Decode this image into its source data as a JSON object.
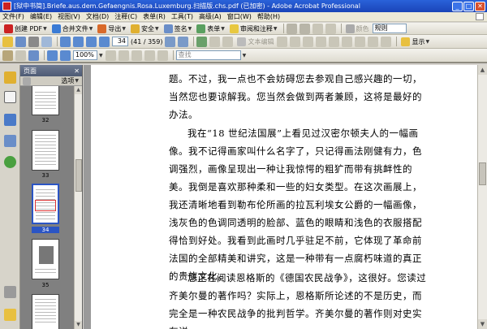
{
  "window": {
    "title": "[狱中书简].Briefe.aus.dem.Gefaengnis.Rosa.Luxemburg.扫描版.chs.pdf (已加密) - Adobe Acrobat Professional"
  },
  "menu": [
    "文件(F)",
    "编辑(E)",
    "视图(V)",
    "文档(D)",
    "注释(C)",
    "表单(R)",
    "工具(T)",
    "高级(A)",
    "窗口(W)",
    "帮助(H)"
  ],
  "toolbar1": {
    "create_pdf": "创建 PDF",
    "combine": "合并文件",
    "export": "导出",
    "secure": "安全",
    "sign": "签名",
    "forms": "表单",
    "review": "审阅和注释",
    "color_label": "颜色",
    "mode_value": "规则"
  },
  "toolbar2": {
    "page_current": "34",
    "page_total": "(41 / 359)",
    "text_edit": "文本编辑",
    "show": "显示"
  },
  "toolbar3": {
    "zoom": "100%",
    "find_placeholder": "查找"
  },
  "panel": {
    "title": "页面",
    "options": "选项",
    "thumbnails": [
      {
        "label": "32",
        "selected": false
      },
      {
        "label": "33",
        "selected": false
      },
      {
        "label": "34",
        "selected": true
      },
      {
        "label": "35",
        "selected": false
      }
    ]
  },
  "document": {
    "paragraphs": [
      "题。不过，我一点也不会妨碍您去参观自己感兴趣的一切，当然您也要谅解我。您当然会做到两者兼顾，这将是最好的办法。",
      "我在“18 世纪法国展”上看见过汉密尔顿夫人的一幅画像。我不记得画家叫什么名字了，只记得画法刚健有力，色调强烈，画像呈现出一种让我惊愕的粗犷而带有挑衅性的美。我倒是喜欢那种柔和一些的妇女类型。在这次画展上，我还清晰地看到勒布伦所画的拉瓦利埃女公爵的一幅画像，浅灰色的色调同透明的脸部、蓝色的眼睛和浅色的衣服搭配得恰到好处。我看到此画时几乎驻足不前，它体现了革命前法国的全部精美和讲究，这是一种带有一点腐朽味道的真正的贵族文化。",
      "您正在阅读恩格斯的《德国农民战争》，这很好。您读过齐美尔曼的著作吗？实际上，恩格斯所论述的不是历史，而完全是一种农民战争的批判哲学。齐美尔曼的著作则对史实有详"
    ]
  },
  "colors": {
    "titlebar": "#1a44b8",
    "accent": "#2b55c4",
    "pdf_red": "#c22"
  }
}
